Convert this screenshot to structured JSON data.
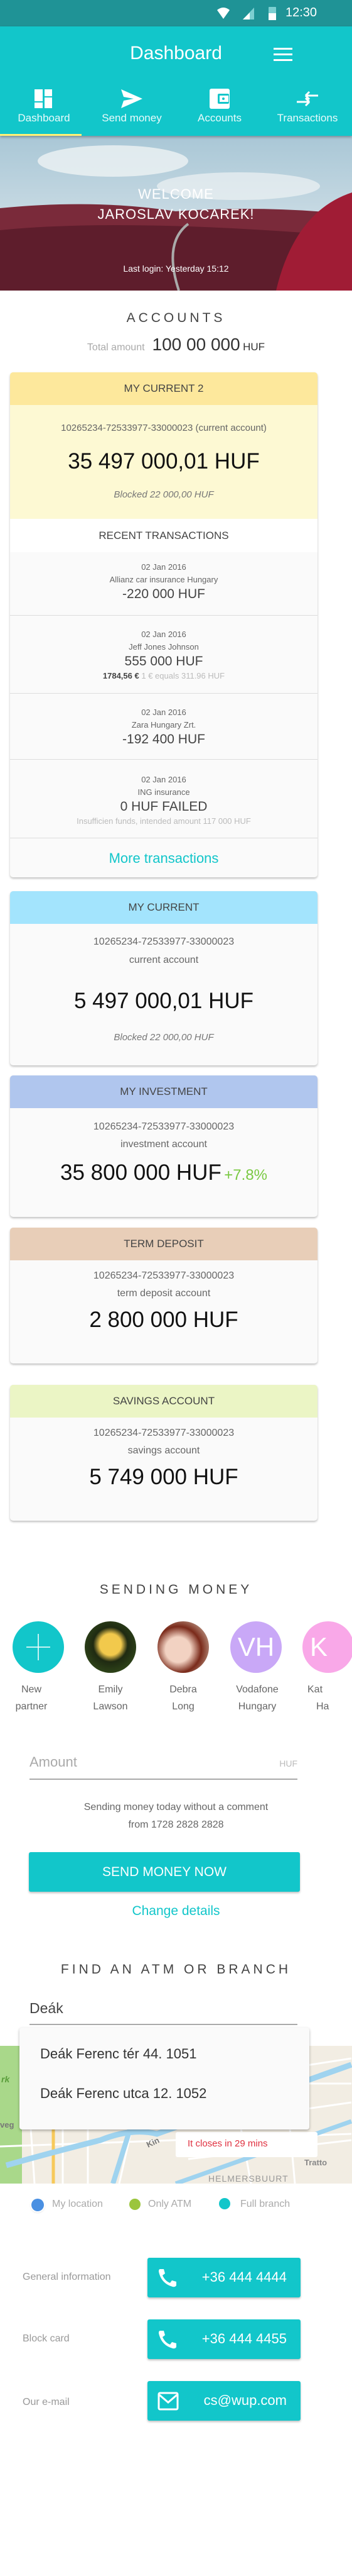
{
  "status_bar": {
    "time": "12:30",
    "icons": [
      "wifi-icon",
      "signal-icon",
      "battery-icon"
    ]
  },
  "header": {
    "title": "Dashboard",
    "menu_icon": "hamburger-menu-icon"
  },
  "tabs": [
    {
      "label": "Dashboard",
      "icon": "dashboard-icon",
      "active": true
    },
    {
      "label": "Send money",
      "icon": "send-icon"
    },
    {
      "label": "Accounts",
      "icon": "wallet-icon"
    },
    {
      "label": "Transactions",
      "icon": "transfer-arrows-icon"
    }
  ],
  "hero": {
    "welcome": "WELCOME",
    "name": "JAROSLAV KOCAREK!",
    "last_login": "Last login: Yesterday 15:12"
  },
  "accounts": {
    "title": "ACCOUNTS",
    "total_label": "Total amount",
    "total_value": "100 00 000",
    "total_currency": "HUF",
    "featured": {
      "name": "MY CURRENT 2",
      "number": "10265234-72533977-33000023 (current account)",
      "amount": "35 497 000,01 HUF",
      "blocked": "Blocked 22 000,00 HUF",
      "header_color": "#FDE89C",
      "body_color": "#FDF9D3"
    },
    "recent": {
      "title": "RECENT TRANSACTIONS",
      "more": "More transactions",
      "items": [
        {
          "date": "02 Jan  2016",
          "party": "Allianz car insurance Hungary",
          "amount": "-220 000 HUF"
        },
        {
          "date": "02 Jan  2016",
          "party": "Jeff Jones Johnson",
          "amount": "555 000 HUF",
          "fx_amount": "1784,56 €",
          "fx_rate": "1 € equals 311.96 HUF"
        },
        {
          "date": "02 Jan  2016",
          "party": "Zara Hungary Zrt.",
          "amount": "-192 400 HUF"
        },
        {
          "date": "02  Jan  2016",
          "party": "ING insurance",
          "amount": "0 HUF FAILED",
          "note": "Insufficien funds, intended amount 117 000 HUF"
        }
      ]
    },
    "cards": [
      {
        "name": "MY CURRENT",
        "number": "10265234-72533977-33000023",
        "type": "current account",
        "amount": "5 497 000,01 HUF",
        "blocked": "Blocked 22 000,00 HUF",
        "color": "#A3E4FD"
      },
      {
        "name": "MY INVESTMENT",
        "number": "10265234-72533977-33000023",
        "type": "investment account",
        "amount": "35 800 000 HUF",
        "change": "+7.8%",
        "color": "#B0C6EE"
      },
      {
        "name": "TERM DEPOSIT",
        "number": "10265234-72533977-33000023",
        "type": "term deposit  account",
        "amount": "2 800 000 HUF",
        "color": "#E8CEB8"
      },
      {
        "name": "SAVINGS ACCOUNT",
        "number": "10265234-72533977-33000023",
        "type": "savings  account",
        "amount": "5 749 000 HUF",
        "color": "#EBF5C5"
      }
    ]
  },
  "sending": {
    "title": "SENDING MONEY",
    "partners": [
      {
        "line1": "New",
        "line2": "partner",
        "icon": "plus-icon"
      },
      {
        "line1": "Emily",
        "line2": "Lawson"
      },
      {
        "line1": "Debra",
        "line2": "Long"
      },
      {
        "line1": "Vodafone",
        "line2": "Hungary",
        "initials": "VH",
        "color": "#C9A8F7"
      },
      {
        "line1": "Kat",
        "line2": "Ha",
        "initials": "K",
        "color": "#F9A8E8"
      }
    ],
    "amount_placeholder": "Amount",
    "currency": "HUF",
    "note_line1": "Sending money today without a comment",
    "note_line2": "from 1728 2828 2828",
    "send_button": "SEND MONEY NOW",
    "change_link": "Change details"
  },
  "atm": {
    "title": "FIND AN ATM OR BRANCH",
    "search_value": "Deák",
    "suggestions": [
      "Deák Ferenc tér 44. 1051",
      "Deák Ferenc utca 12. 1052"
    ],
    "closing": "It closes in 29 mins",
    "map_labels": [
      "HELMERSBUURT",
      "straat",
      "aat",
      "Kin",
      "veg",
      "rk",
      "gue",
      "Tratto"
    ],
    "legend": [
      {
        "label": "My location",
        "color": "#4A90E2"
      },
      {
        "label": "Only ATM",
        "color": "#9BC53D"
      },
      {
        "label": "Full branch",
        "color": "#12C6CA"
      }
    ]
  },
  "contacts": [
    {
      "label": "General information",
      "value": "+36 444 4444",
      "icon": "phone-icon"
    },
    {
      "label": "Block card",
      "value": "+36 444 4455",
      "icon": "phone-icon"
    },
    {
      "label": "Our  e-mail",
      "value": "cs@wup.com",
      "icon": "mail-icon"
    }
  ],
  "colors": {
    "accent": "#12C6CA",
    "status_bar": "#1F9396",
    "tab_indicator": "#FFF176",
    "positive": "#7AC943",
    "warning": "#E0303F"
  }
}
